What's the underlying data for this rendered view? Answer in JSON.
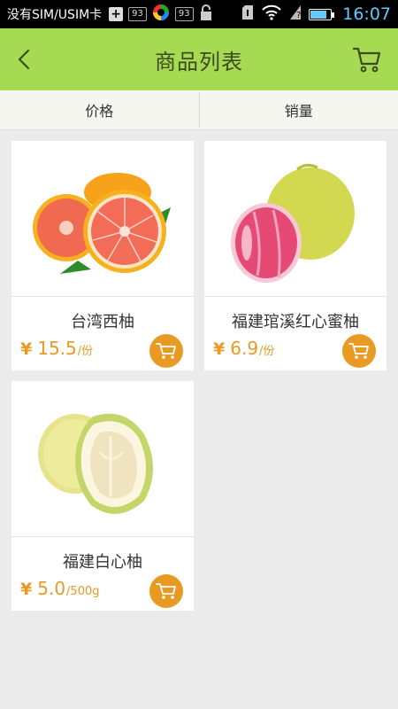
{
  "status_bar": {
    "carrier": "没有SIM/USIM卡",
    "badge_a": "93",
    "badge_b": "93",
    "time": "16:07",
    "battery_level": 0.8
  },
  "header": {
    "title": "商品列表"
  },
  "sort_tabs": [
    {
      "label": "价格"
    },
    {
      "label": "销量"
    }
  ],
  "products": [
    {
      "name": "台湾西柚",
      "currency": "¥",
      "price": "15.5",
      "unit": "/份"
    },
    {
      "name": "福建琯溪红心蜜柚",
      "currency": "¥",
      "price": "6.9",
      "unit": "/份"
    },
    {
      "name": "福建白心柚",
      "currency": "¥",
      "price": "5.0",
      "unit": "/500g"
    }
  ],
  "colors": {
    "header_bg": "#a5da52",
    "accent": "#e89a22",
    "page_bg": "#ebebeb"
  }
}
